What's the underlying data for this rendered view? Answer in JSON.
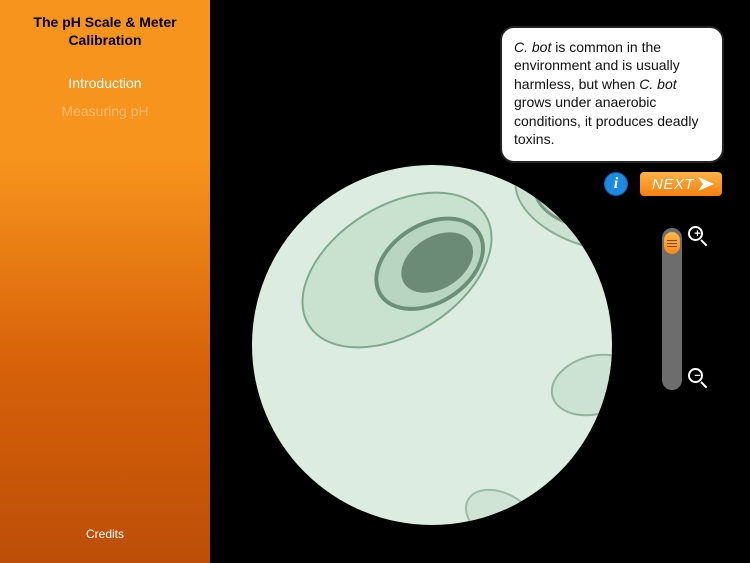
{
  "sidebar": {
    "title": "The pH Scale & Meter Calibration",
    "nav": [
      {
        "label": "Introduction",
        "active": true
      },
      {
        "label": "Measuring pH",
        "active": false
      }
    ],
    "credits": "Credits"
  },
  "bubble": {
    "text_html": "<em>C. bot</em> is common in the environment and is usually harmless, but when <em>C. bot</em> grows under anaerobic conditions, it produces deadly toxins."
  },
  "controls": {
    "info_label": "i",
    "next_label": "NEXT",
    "zoom_plus": "+",
    "zoom_minus": "−"
  },
  "icons": {
    "info": "info-icon",
    "next_arrow": "chevron-right-icon",
    "zoom_in": "magnify-plus-icon",
    "zoom_out": "magnify-minus-icon"
  },
  "colors": {
    "accent": "#f7941d",
    "bg": "#000000",
    "bubble_bg": "#ffffff"
  }
}
